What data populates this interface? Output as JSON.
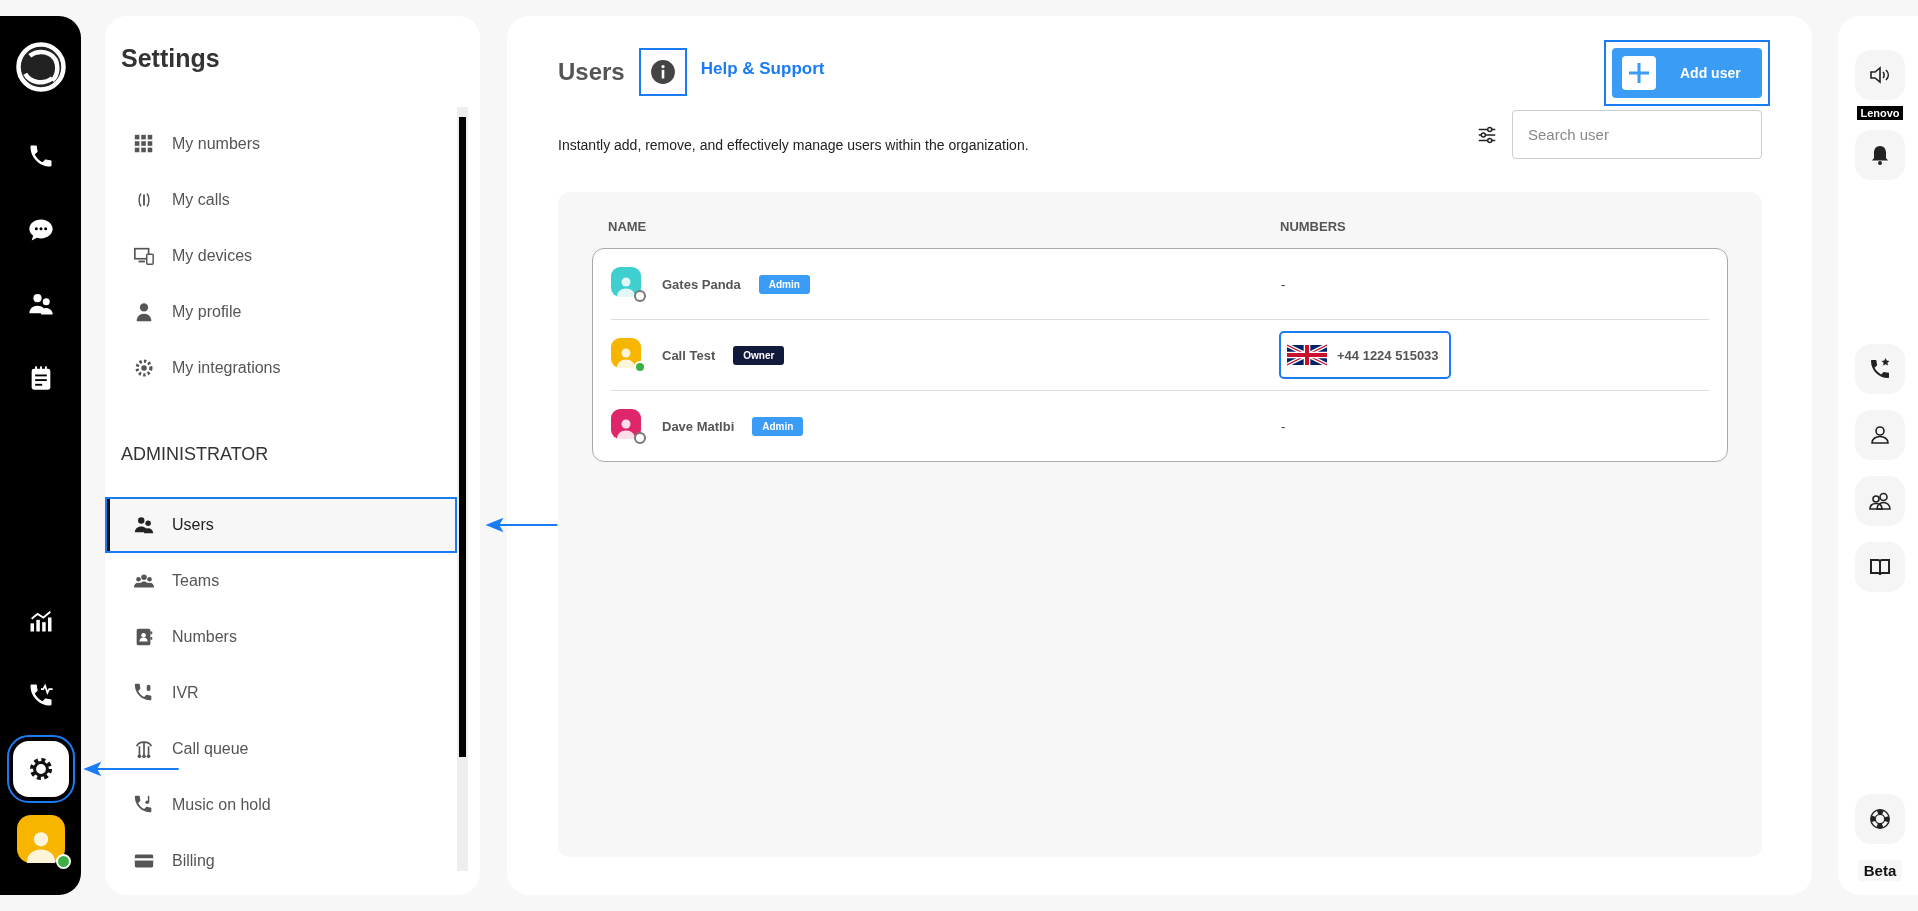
{
  "rail": {
    "top_items": [
      {
        "selected": false,
        "highlighted": false
      },
      {
        "selected": false,
        "highlighted": false
      },
      {
        "selected": false,
        "highlighted": false
      },
      {
        "selected": false,
        "highlighted": false
      }
    ],
    "bottom_items": [
      {
        "selected": false,
        "highlighted": false
      },
      {
        "selected": false,
        "highlighted": false
      },
      {
        "selected": true,
        "highlighted": true
      }
    ],
    "profile": {
      "online": true
    }
  },
  "settings": {
    "title": "Settings",
    "personal_items": [
      {
        "label": "My numbers",
        "selected": false,
        "highlighted": false
      },
      {
        "label": "My calls",
        "selected": false,
        "highlighted": false
      },
      {
        "label": "My devices",
        "selected": false,
        "highlighted": false
      },
      {
        "label": "My profile",
        "selected": false,
        "highlighted": false
      },
      {
        "label": "My integrations",
        "selected": false,
        "highlighted": false
      }
    ],
    "admin": {
      "heading": "ADMINISTRATOR",
      "items": [
        {
          "label": "Users",
          "selected": true,
          "highlighted": true
        },
        {
          "label": "Teams",
          "selected": false,
          "highlighted": false
        },
        {
          "label": "Numbers",
          "selected": false,
          "highlighted": false
        },
        {
          "label": "IVR",
          "selected": false,
          "highlighted": false
        },
        {
          "label": "Call queue",
          "selected": false,
          "highlighted": false
        },
        {
          "label": "Music on hold",
          "selected": false,
          "highlighted": false
        },
        {
          "label": "Billing",
          "selected": false,
          "highlighted": false
        }
      ]
    }
  },
  "main": {
    "title": "Users",
    "info_button": {
      "highlighted": true
    },
    "help_link": "Help & Support",
    "add_button": {
      "label": "Add user",
      "highlighted": true
    },
    "description": "Instantly add, remove, and effectively manage users within the organization.",
    "search": {
      "placeholder": "Search user"
    },
    "table": {
      "columns": [
        "NAME",
        "NUMBERS"
      ],
      "rows": [
        {
          "name": "Gates Panda",
          "color": "#3fcfcf",
          "online": false,
          "role": {
            "label": "Admin",
            "kind": "admin"
          },
          "number": {
            "kind": "none",
            "text": "-"
          }
        },
        {
          "name": "Call Test",
          "color": "#f7b500",
          "online": true,
          "role": {
            "label": "Owner",
            "kind": "owner"
          },
          "number": {
            "kind": "uk",
            "text": "+44 1224 515033",
            "highlighted": true
          }
        },
        {
          "name": "Dave Matlbi",
          "color": "#e0266a",
          "online": false,
          "role": {
            "label": "Admin",
            "kind": "admin"
          },
          "number": {
            "kind": "none",
            "text": "-"
          }
        }
      ]
    }
  },
  "right_rail": {
    "device_label": "Lenovo",
    "beta": "Beta"
  }
}
